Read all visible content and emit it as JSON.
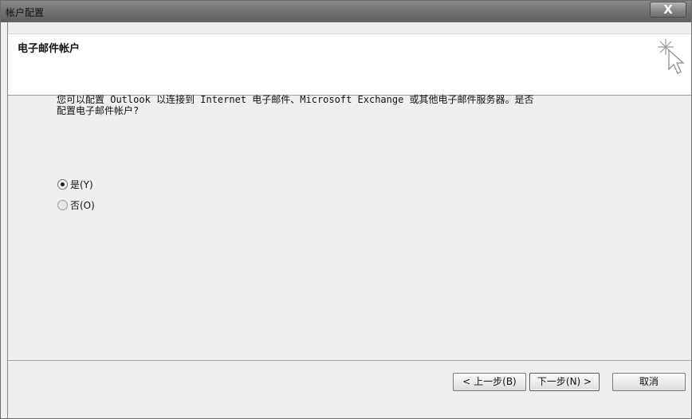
{
  "window": {
    "title": "帐户配置",
    "close_label": "X"
  },
  "header": {
    "title": "电子邮件帐户",
    "icon": "wizard-cursor-icon"
  },
  "body": {
    "description_line1": "您可以配置 Outlook 以连接到 Internet 电子邮件、Microsoft Exchange 或其他电子邮件服务器。是否",
    "description_line2": "配置电子邮件帐户?"
  },
  "options": {
    "yes_label": "是(Y)",
    "no_label": "否(O)",
    "selected": "yes"
  },
  "buttons": {
    "back_label": "< 上一步(B)",
    "next_label": "下一步(N) >",
    "cancel_label": "取消"
  }
}
